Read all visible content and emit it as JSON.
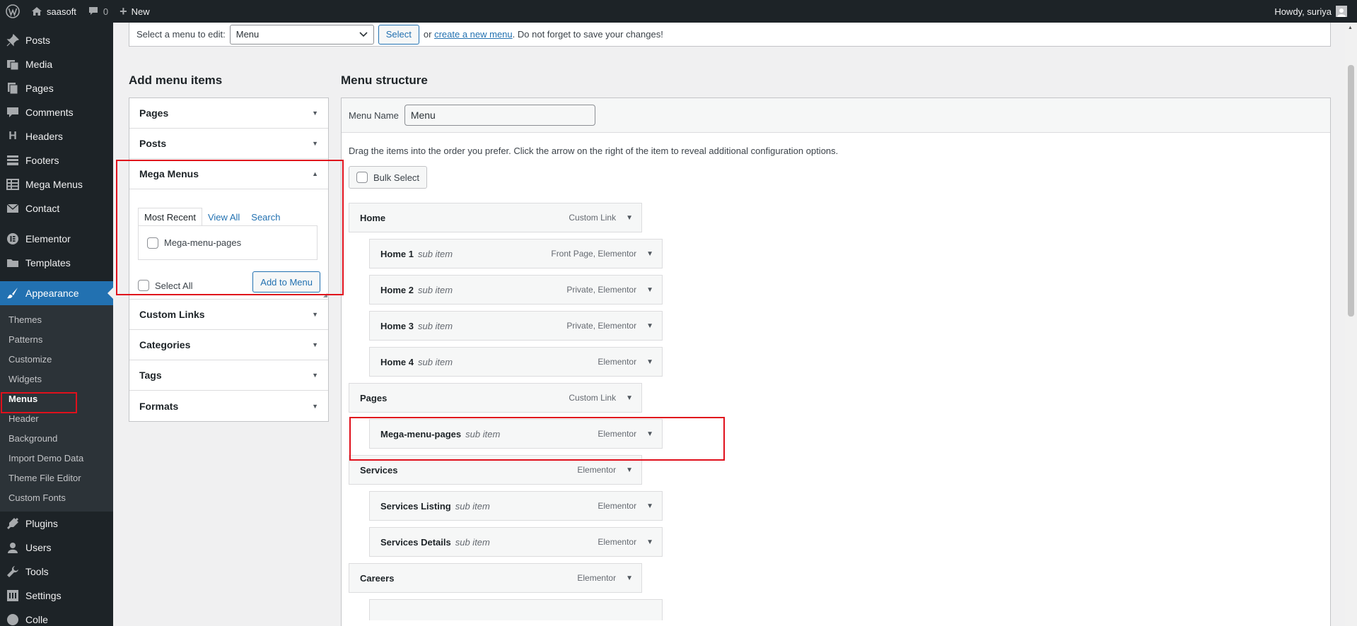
{
  "admin_bar": {
    "site_name": "saasoft",
    "comments_count": "0",
    "new_label": "New",
    "howdy": "Howdy, suriya"
  },
  "sidebar": {
    "top_items": [
      {
        "label": "Posts",
        "icon": "pushpin-icon"
      },
      {
        "label": "Media",
        "icon": "media-icon"
      },
      {
        "label": "Pages",
        "icon": "pages-icon"
      },
      {
        "label": "Comments",
        "icon": "comment-icon"
      },
      {
        "label": "Headers",
        "icon": "heading-icon"
      },
      {
        "label": "Footers",
        "icon": "footer-icon"
      },
      {
        "label": "Mega Menus",
        "icon": "table-icon"
      },
      {
        "label": "Contact",
        "icon": "mail-icon"
      }
    ],
    "mid_items": [
      {
        "label": "Elementor",
        "icon": "elementor-icon"
      },
      {
        "label": "Templates",
        "icon": "folder-icon"
      }
    ],
    "appearance": "Appearance",
    "sub_items": [
      "Themes",
      "Patterns",
      "Customize",
      "Widgets",
      "Menus",
      "Header",
      "Background",
      "Import Demo Data",
      "Theme File Editor",
      "Custom Fonts"
    ],
    "bottom_items": [
      {
        "label": "Plugins",
        "icon": "plugin-icon"
      },
      {
        "label": "Users",
        "icon": "user-icon"
      },
      {
        "label": "Tools",
        "icon": "wrench-icon"
      },
      {
        "label": "Settings",
        "icon": "settings-icon"
      },
      {
        "label": "Colle",
        "icon": "collapse-icon"
      }
    ]
  },
  "menu_select": {
    "prompt": "Select a menu to edit:",
    "selected": "Menu",
    "select_button": "Select",
    "or": "or",
    "create_link": "create a new menu",
    "suffix": ". Do not forget to save your changes!"
  },
  "add_items": {
    "heading": "Add menu items",
    "sections": [
      "Pages",
      "Posts",
      "Mega Menus",
      "Custom Links",
      "Categories",
      "Tags",
      "Formats"
    ],
    "tabs": [
      "Most Recent",
      "View All",
      "Search"
    ],
    "recent_item": "Mega-menu-pages",
    "select_all": "Select All",
    "add_button": "Add to Menu"
  },
  "structure": {
    "heading": "Menu structure",
    "name_label": "Menu Name",
    "name_value": "Menu",
    "instructions": "Drag the items into the order you prefer. Click the arrow on the right of the item to reveal additional configuration options.",
    "bulk_select": "Bulk Select",
    "items": [
      {
        "title": "Home",
        "sub": "",
        "type": "Custom Link",
        "depth": 0
      },
      {
        "title": "Home 1",
        "sub": "sub item",
        "type": "Front Page, Elementor",
        "depth": 1
      },
      {
        "title": "Home 2",
        "sub": "sub item",
        "type": "Private, Elementor",
        "depth": 1
      },
      {
        "title": "Home 3",
        "sub": "sub item",
        "type": "Private, Elementor",
        "depth": 1
      },
      {
        "title": "Home 4",
        "sub": "sub item",
        "type": "Elementor",
        "depth": 1
      },
      {
        "title": "Pages",
        "sub": "",
        "type": "Custom Link",
        "depth": 0
      },
      {
        "title": "Mega-menu-pages",
        "sub": "sub item",
        "type": "Elementor",
        "depth": 1
      },
      {
        "title": "Services",
        "sub": "",
        "type": "Elementor",
        "depth": 0
      },
      {
        "title": "Services Listing",
        "sub": "sub item",
        "type": "Elementor",
        "depth": 1
      },
      {
        "title": "Services Details",
        "sub": "sub item",
        "type": "Elementor",
        "depth": 1
      },
      {
        "title": "Careers",
        "sub": "",
        "type": "Elementor",
        "depth": 0
      }
    ]
  },
  "colors": {
    "admin_dark": "#1d2327",
    "accent": "#2271b1",
    "highlight_red": "#e0101c"
  }
}
